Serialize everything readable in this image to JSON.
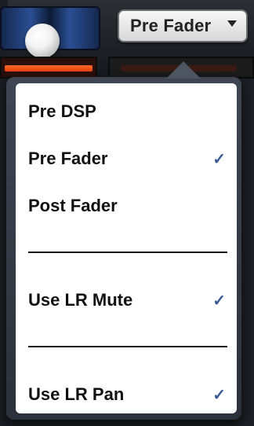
{
  "top_button": {
    "label": "Pre Fader"
  },
  "menu": {
    "items": [
      {
        "label": "Pre DSP",
        "checked": false
      },
      {
        "label": "Pre Fader",
        "checked": true
      },
      {
        "label": "Post Fader",
        "checked": false
      },
      {
        "label": "Use LR Mute",
        "checked": true
      },
      {
        "label": "Use LR Pan",
        "checked": true
      }
    ],
    "check_glyph": "✓"
  },
  "colors": {
    "check": "#3b5a94",
    "meter_red": "#e2410f"
  }
}
